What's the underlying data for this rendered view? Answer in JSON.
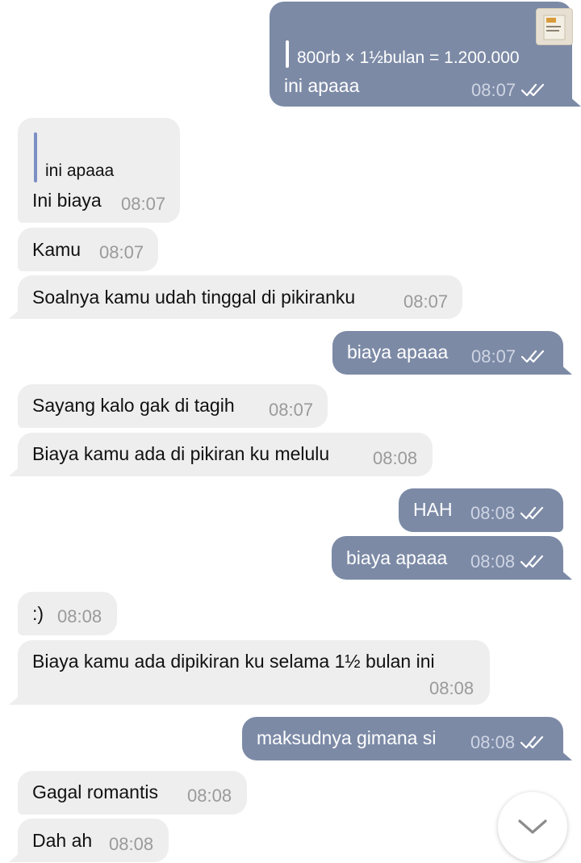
{
  "messages": [
    {
      "id": "m1",
      "side": "out",
      "quote": {
        "text": "800rb × 1½bulan = 1.200.000"
      },
      "text": "ini apaaa",
      "time": "08:07",
      "status": "read"
    },
    {
      "id": "m2",
      "side": "in",
      "quote": {
        "text": "ini apaaa"
      },
      "text": "Ini biaya",
      "time": "08:07"
    },
    {
      "id": "m3",
      "side": "in",
      "text": "Kamu",
      "time": "08:07"
    },
    {
      "id": "m4",
      "side": "in",
      "text": "Soalnya kamu udah tinggal di pikiranku",
      "time": "08:07"
    },
    {
      "id": "m5",
      "side": "out",
      "text": "biaya apaaa",
      "time": "08:07",
      "status": "read"
    },
    {
      "id": "m6",
      "side": "in",
      "text": "Sayang kalo gak di tagih",
      "time": "08:07"
    },
    {
      "id": "m7",
      "side": "in",
      "text": "Biaya kamu ada di pikiran ku melulu",
      "time": "08:08"
    },
    {
      "id": "m8",
      "side": "out",
      "text": "HAH",
      "time": "08:08",
      "status": "read"
    },
    {
      "id": "m9",
      "side": "out",
      "text": "biaya apaaa",
      "time": "08:08",
      "status": "read"
    },
    {
      "id": "m10",
      "side": "in",
      "text": ":)",
      "time": "08:08"
    },
    {
      "id": "m11",
      "side": "in",
      "text": "Biaya kamu ada dipikiran ku selama 1½ bulan ini",
      "time": "08:08"
    },
    {
      "id": "m12",
      "side": "out",
      "text": "maksudnya gimana si",
      "time": "08:08",
      "status": "read"
    },
    {
      "id": "m13",
      "side": "in",
      "text": "Gagal romantis",
      "time": "08:08"
    },
    {
      "id": "m14",
      "side": "in",
      "text": "Dah ah",
      "time": "08:08"
    }
  ],
  "icons": {
    "read_receipt": "double-check-icon",
    "scroll_down": "chevron-down-icon",
    "quote_thumbnail": "image-thumbnail-icon"
  },
  "colors": {
    "incoming_bubble": "#eeeeee",
    "outgoing_bubble": "#7c8aa6",
    "incoming_time": "#9a9a9a",
    "outgoing_time": "#cfd5e3",
    "quote_bar": "#7b8fc4"
  }
}
